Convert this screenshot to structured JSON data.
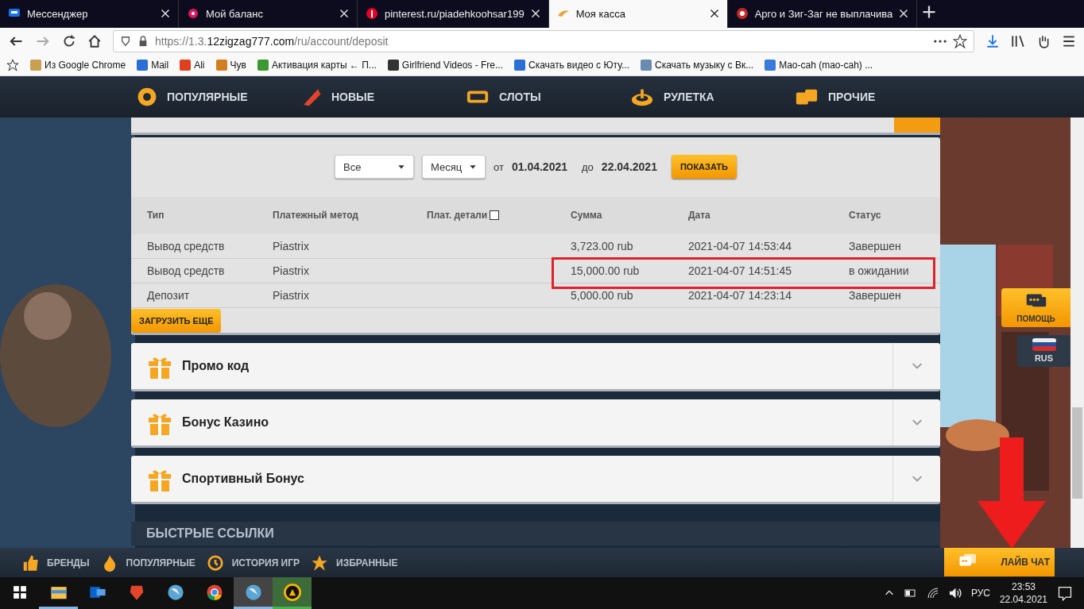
{
  "browser": {
    "tabs": [
      {
        "title": "Мессенджер",
        "selected": false
      },
      {
        "title": "Мой баланс",
        "selected": false
      },
      {
        "title": "pinterest.ru/piadehkoohsar199",
        "selected": false
      },
      {
        "title": "Моя касса",
        "selected": true
      },
      {
        "title": "Арго и Зиг-Заг не выплачива",
        "selected": false
      }
    ],
    "url": "https://1.3.**12zigzag777.com**/ru/account/deposit",
    "bookmarks": [
      "Из Google Chrome",
      "Mail",
      "Ali",
      "Чув",
      "Активация карты ← П...",
      "Girlfriend Videos - Fre...",
      "Скачать видео с Юту...",
      "Скачать музыку с Вк...",
      "Mao-cah (mao-cah) ..."
    ]
  },
  "site_nav": [
    "ПОПУЛЯРНЫЕ",
    "НОВЫЕ",
    "СЛОТЫ",
    "РУЛЕТКА",
    "ПРОЧИЕ"
  ],
  "filters": {
    "type": "Все",
    "period": "Месяц",
    "from_label": "от",
    "from": "01.04.2021",
    "to_label": "до",
    "to": "22.04.2021",
    "button": "ПОКАЗАТЬ"
  },
  "table": {
    "columns": [
      "Тип",
      "Платежный метод",
      "Плат. детали",
      "Сумма",
      "Дата",
      "Статус"
    ],
    "details_checked": false,
    "rows": [
      {
        "cells": [
          "Вывод средств",
          "Piastrix",
          "",
          "3,723.00 rub",
          "2021-04-07 14:53:44",
          "Завершен"
        ],
        "highlighted": false
      },
      {
        "cells": [
          "Вывод средств",
          "Piastrix",
          "",
          "15,000.00 rub",
          "2021-04-07 14:51:45",
          "в ожидании"
        ],
        "highlighted": true
      },
      {
        "cells": [
          "Депозит",
          "Piastrix",
          "",
          "5,000.00 rub",
          "2021-04-07 14:23:14",
          "Завершен"
        ],
        "highlighted": false
      }
    ]
  },
  "load_more": "ЗАГРУЗИТЬ ЕЩЕ",
  "accordions": [
    {
      "title": "Промо код",
      "expanded": false
    },
    {
      "title": "Бонус Казино",
      "expanded": false
    },
    {
      "title": "Спортивный Бонус",
      "expanded": false
    }
  ],
  "quick_links": "БЫСТРЫЕ ССЫЛКИ",
  "side_buttons": {
    "help": "ПОМОЩЬ",
    "language": "RUS"
  },
  "bottom_bar": {
    "items": [
      "БРЕНДЫ",
      "ПОПУЛЯРНЫЕ",
      "ИСТОРИЯ ИГР",
      "ИЗБРАННЫЕ"
    ],
    "live_chat": "ЛАЙВ ЧАТ"
  },
  "taskbar": {
    "apps": [
      {
        "kind": "folder",
        "running": true,
        "selected": false
      },
      {
        "kind": "mail",
        "running": false,
        "selected": false
      },
      {
        "kind": "lion",
        "running": false,
        "selected": false
      },
      {
        "kind": "globe",
        "running": false,
        "selected": false
      },
      {
        "kind": "chrome",
        "running": false,
        "selected": false
      },
      {
        "kind": "globe",
        "running": true,
        "selected": true
      },
      {
        "kind": "casino",
        "running": true,
        "selected": true
      }
    ],
    "language": "РУС",
    "time": "23:53",
    "date": "22.04.2021"
  }
}
